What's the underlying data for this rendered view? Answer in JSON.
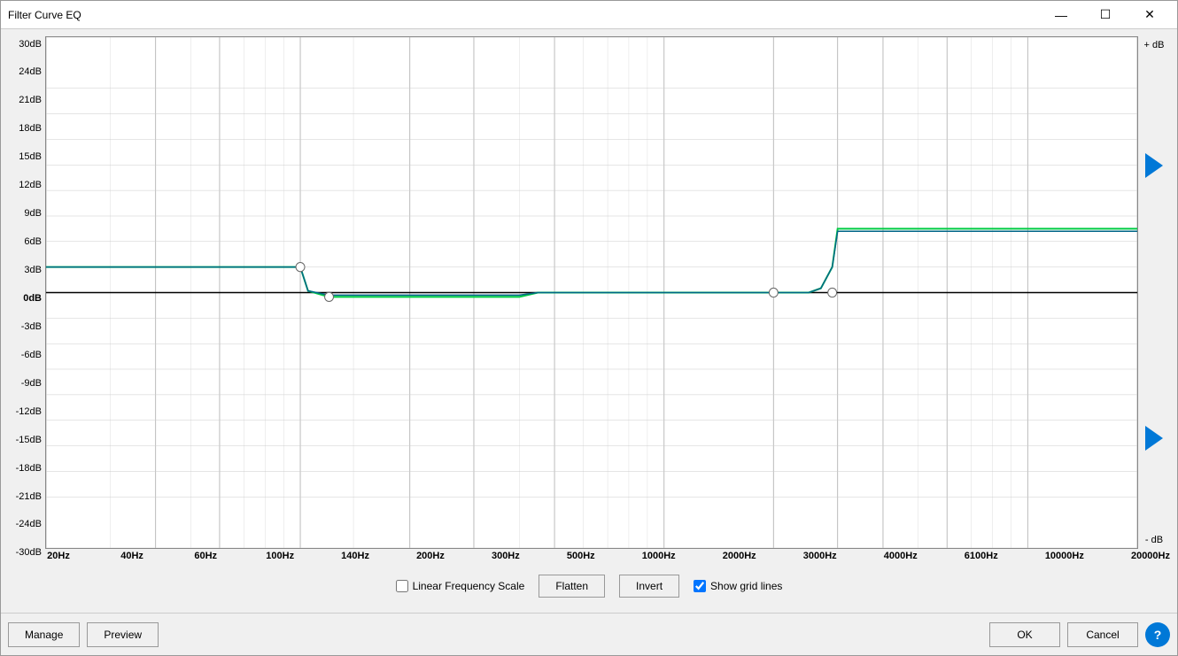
{
  "window": {
    "title": "Filter Curve EQ",
    "minimize_label": "—",
    "maximize_label": "☐",
    "close_label": "✕"
  },
  "y_axis": {
    "labels": [
      "30dB",
      "24dB",
      "21dB",
      "18dB",
      "15dB",
      "12dB",
      "9dB",
      "6dB",
      "3dB",
      "0dB",
      "-3dB",
      "-6dB",
      "-9dB",
      "-12dB",
      "-15dB",
      "-18dB",
      "-21dB",
      "-24dB",
      "-30dB"
    ],
    "plus_label": "+ dB",
    "minus_label": "- dB"
  },
  "x_axis": {
    "labels": [
      "20Hz",
      "40Hz",
      "60Hz",
      "100Hz",
      "140Hz",
      "200Hz",
      "300Hz",
      "500Hz",
      "1000Hz",
      "2000Hz",
      "3000Hz",
      "4000Hz",
      "6100Hz",
      "10000Hz",
      "20000Hz"
    ]
  },
  "controls": {
    "linear_scale_label": "Linear Frequency Scale",
    "linear_scale_checked": false,
    "flatten_label": "Flatten",
    "invert_label": "Invert",
    "show_grid_label": "Show grid lines",
    "show_grid_checked": true
  },
  "bottom_bar": {
    "manage_label": "Manage",
    "preview_label": "Preview",
    "ok_label": "OK",
    "cancel_label": "Cancel",
    "help_label": "?"
  }
}
